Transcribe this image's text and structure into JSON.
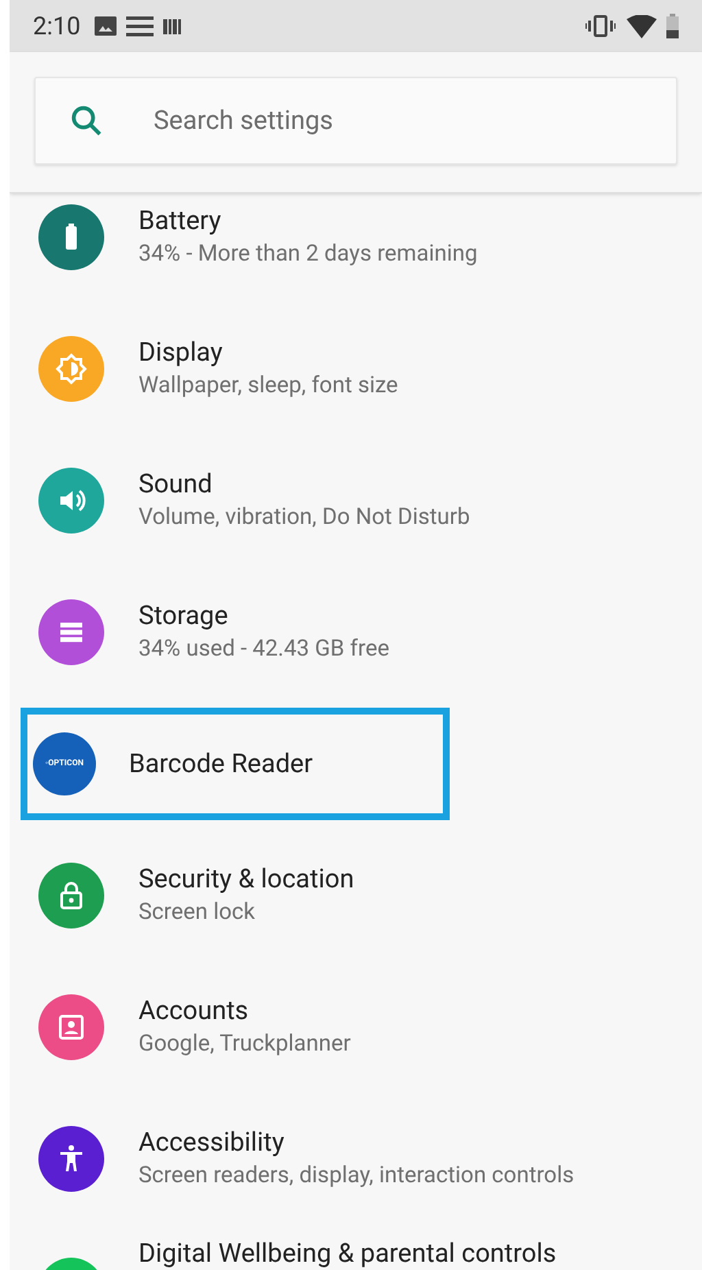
{
  "status_bar": {
    "time": "2:10"
  },
  "search": {
    "placeholder": "Search settings"
  },
  "items": [
    {
      "kind": "battery",
      "title": "Battery",
      "subtitle": "34% - More than 2 days remaining",
      "color": "#18776f",
      "selected": false
    },
    {
      "kind": "display",
      "title": "Display",
      "subtitle": "Wallpaper, sleep, font size",
      "color": "#f9a825",
      "selected": false
    },
    {
      "kind": "sound",
      "title": "Sound",
      "subtitle": "Volume, vibration, Do Not Disturb",
      "color": "#1fa79b",
      "selected": false
    },
    {
      "kind": "storage",
      "title": "Storage",
      "subtitle": "34% used - 42.43 GB free",
      "color": "#b14fd8",
      "selected": false
    },
    {
      "kind": "logo",
      "title": "Barcode Reader",
      "logo_text": "◦OPTICON",
      "color": "#1560b8",
      "selected": true
    },
    {
      "kind": "security",
      "title": "Security & location",
      "subtitle": "Screen lock",
      "color": "#1e9e50",
      "selected": false
    },
    {
      "kind": "accounts",
      "title": "Accounts",
      "subtitle": "Google, Truckplanner",
      "color": "#ec4d86",
      "selected": false
    },
    {
      "kind": "accessibility",
      "title": "Accessibility",
      "subtitle": "Screen readers, display, interaction controls",
      "color": "#5a1fd0",
      "selected": false
    },
    {
      "kind": "wellbeing",
      "title": "Digital Wellbeing & parental controls",
      "color": "#14c35a",
      "selected": false
    }
  ]
}
